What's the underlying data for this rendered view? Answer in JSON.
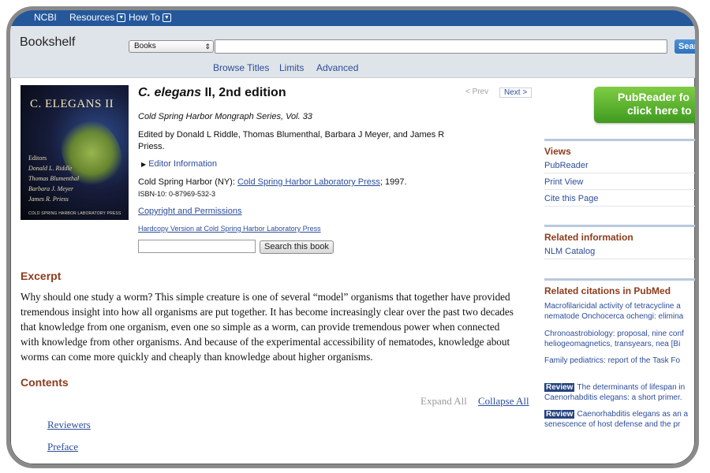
{
  "topnav": {
    "logo": "NCBI",
    "resources": "Resources",
    "howto": "How To"
  },
  "search": {
    "brand": "Bookshelf",
    "database": "Books",
    "query": "",
    "button": "Search",
    "links": [
      "Browse Titles",
      "Limits",
      "Advanced"
    ]
  },
  "book": {
    "cover": {
      "title": "C. ELEGANS II",
      "editors_heading": "Editors",
      "editors": [
        "Donald L. Riddle",
        "Thomas Blumenthal",
        "Barbara J. Meyer",
        "James R. Priess"
      ],
      "publisher": "COLD SPRING HARBOR LABORATORY PRESS"
    },
    "title_italic": "C. elegans",
    "title_rest": " II, 2nd edition",
    "series": "Cold Spring Harbor Mongraph Series, Vol. 33",
    "editors_line1": "Edited by Donald L Riddle, Thomas Blumenthal, Barbara J Meyer, and James R",
    "editors_line2": "Priess.",
    "editor_info": "Editor Information",
    "publisher_prefix": "Cold Spring Harbor (NY): ",
    "publisher_link": "Cold Spring Harbor Laboratory Press",
    "publisher_suffix": "; 1997.",
    "isbn": "ISBN-10: 0-87969-532-3",
    "copyright": "Copyright and Permissions",
    "hardcopy": "Hardcopy Version at Cold Spring Harbor Laboratory Press",
    "search_button": "Search this book",
    "prev": "< Prev",
    "next": "Next >"
  },
  "excerpt": {
    "heading": "Excerpt",
    "lines": [
      "Why should one study a worm? This simple creature is one of several “model” organisms that together have provided",
      "tremendous insight into how all organisms are put together. It has become increasingly clear over the past two decades",
      "that knowledge from one organism, even one so simple as a worm, can provide tremendous power when connected",
      "with knowledge from other organisms. And because of the experimental accessibility of nematodes, knowledge about",
      "worms can come more quickly and cheaply than knowledge about higher organisms."
    ]
  },
  "contents": {
    "heading": "Contents",
    "expand_all": "Expand All",
    "collapse_all": "Collapse All",
    "items": [
      "Reviewers",
      "Preface"
    ]
  },
  "sidebar": {
    "pubreader_line1": "PubReader fo",
    "pubreader_line2": "click here to",
    "views": {
      "heading": "Views",
      "items": [
        "PubReader",
        "Print View",
        "Cite this Page"
      ]
    },
    "related": {
      "heading": "Related information",
      "items": [
        "NLM Catalog"
      ]
    },
    "citations": {
      "heading": "Related citations in PubMed",
      "items": [
        {
          "badge": "",
          "line1": "Macrofilaricidal activity of tetracycline a",
          "line2": "nematode Onchocerca ochengi: elimina"
        },
        {
          "badge": "",
          "line1": "Chronoastrobiology: proposal, nine conf",
          "line2": "heliogeomagnetics, transyears, nea [Bi"
        },
        {
          "badge": "",
          "line1": "Family pediatrics: report of the Task Fo",
          "line2": ""
        },
        {
          "badge": "Review",
          "line1": "The determinants of lifespan in",
          "line2": "Caenorhabditis elegans: a short primer."
        },
        {
          "badge": "Review",
          "line1": "Caenorhabditis elegans as an a",
          "line2": "senescence of host defense and the pr"
        }
      ]
    }
  }
}
